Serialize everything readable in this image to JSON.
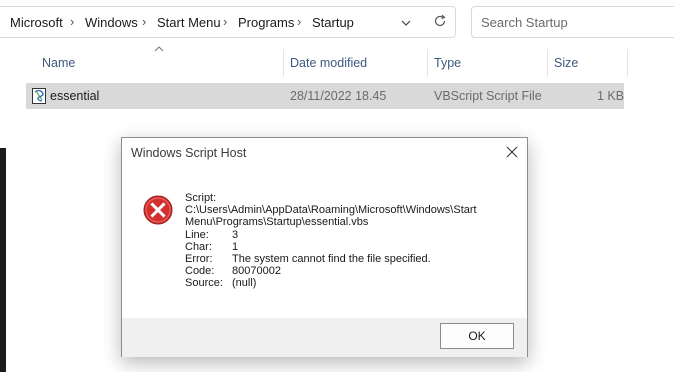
{
  "address_bar": {
    "breadcrumbs": [
      "Microsoft",
      "Windows",
      "Start Menu",
      "Programs",
      "Startup"
    ],
    "search_placeholder": "Search Startup"
  },
  "columns": {
    "name": "Name",
    "date_modified": "Date modified",
    "type": "Type",
    "size": "Size"
  },
  "files": [
    {
      "name": "essential",
      "date_modified": "28/11/2022 18.45",
      "type": "VBScript Script File",
      "size": "1 KB",
      "icon": "vbscript-file-icon"
    }
  ],
  "dialog": {
    "title": "Windows Script Host",
    "icon": "error-icon",
    "script_label": "Script:",
    "script_path_line1": "C:\\Users\\Admin\\AppData\\Roaming\\Microsoft\\Windows\\Start",
    "script_path_line2": "Menu\\Programs\\Startup\\essential.vbs",
    "fields": [
      {
        "key": "Line:",
        "value": "3"
      },
      {
        "key": "Char:",
        "value": "1"
      },
      {
        "key": "Error:",
        "value": "The system cannot find the file specified."
      },
      {
        "key": "Code:",
        "value": "80070002"
      },
      {
        "key": "Source:",
        "value": "(null)"
      }
    ],
    "ok_label": "OK"
  },
  "colors": {
    "selected_row": "#d9d9d9",
    "header_text": "#3d5a80",
    "error_red": "#d32f2f",
    "dialog_footer": "#f0f0f0"
  }
}
